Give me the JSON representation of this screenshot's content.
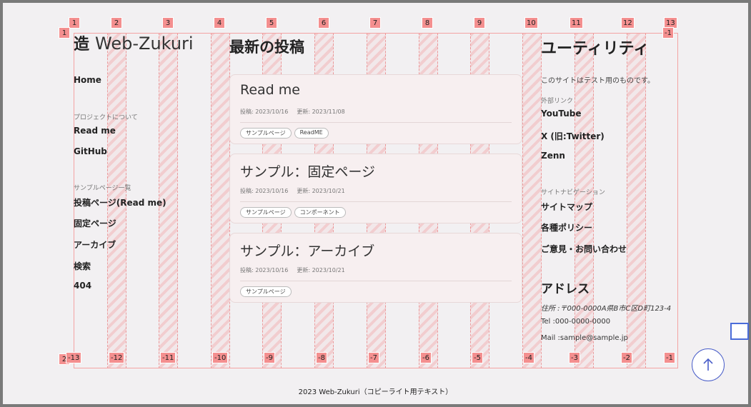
{
  "colors": {
    "accent": "#4a5ec9",
    "grid": "#f48f8f",
    "card_bg": "#f7eff0"
  },
  "grid": {
    "top_badges": [
      "1",
      "2",
      "3",
      "4",
      "5",
      "6",
      "7",
      "8",
      "9",
      "10",
      "11",
      "12",
      "13"
    ],
    "bottom_badges": [
      "-13",
      "-12",
      "-11",
      "-10",
      "-9",
      "-8",
      "-7",
      "-6",
      "-5",
      "-4",
      "-3",
      "-2",
      "-1"
    ],
    "row_start": "1",
    "row_end_top": "-1",
    "row_bottom": "2"
  },
  "site": {
    "logo_mark": "造",
    "logo_text": "Web-Zukuri"
  },
  "left_nav": {
    "home": "Home",
    "project_heading": "プロジェクトについて",
    "project_links": [
      "Read me",
      "GitHub"
    ],
    "samples_heading": "サンプルページ一覧",
    "sample_links": [
      "投稿ページ(Read me)",
      "固定ページ",
      "アーカイブ",
      "検索",
      "404"
    ]
  },
  "main": {
    "title": "最新の投稿",
    "posts": [
      {
        "title": "Read me",
        "posted": "投稿: 2023/10/16",
        "updated": "更新: 2023/11/08",
        "tags": [
          "サンプルページ",
          "ReadME"
        ]
      },
      {
        "title": "サンプル：固定ページ",
        "posted": "投稿: 2023/10/16",
        "updated": "更新: 2023/10/21",
        "tags": [
          "サンプルページ",
          "コンポーネント"
        ]
      },
      {
        "title": "サンプル：アーカイブ",
        "posted": "投稿: 2023/10/16",
        "updated": "更新: 2023/10/21",
        "tags": [
          "サンプルページ"
        ]
      }
    ]
  },
  "sidebar": {
    "title": "ユーティリティ",
    "description": "このサイトはテスト用のものです。",
    "external_heading": "外部リンク",
    "external_links": [
      "YouTube",
      "X (旧:Twitter)",
      "Zenn"
    ],
    "nav_heading": "サイトナビゲーション",
    "nav_links": [
      "サイトマップ",
      "各種ポリシー",
      "ご意見・お問い合わせ"
    ],
    "address_title": "アドレス",
    "address": "住所 :〒000-0000A県B市C区D町123-4",
    "tel": "Tel :000-0000-0000",
    "mail": "Mail :sample@sample.jp"
  },
  "footer": {
    "text": "2023 Web-Zukuri（コピーライト用テキスト）"
  },
  "scroll_top": {
    "icon": "arrow-up-icon"
  }
}
